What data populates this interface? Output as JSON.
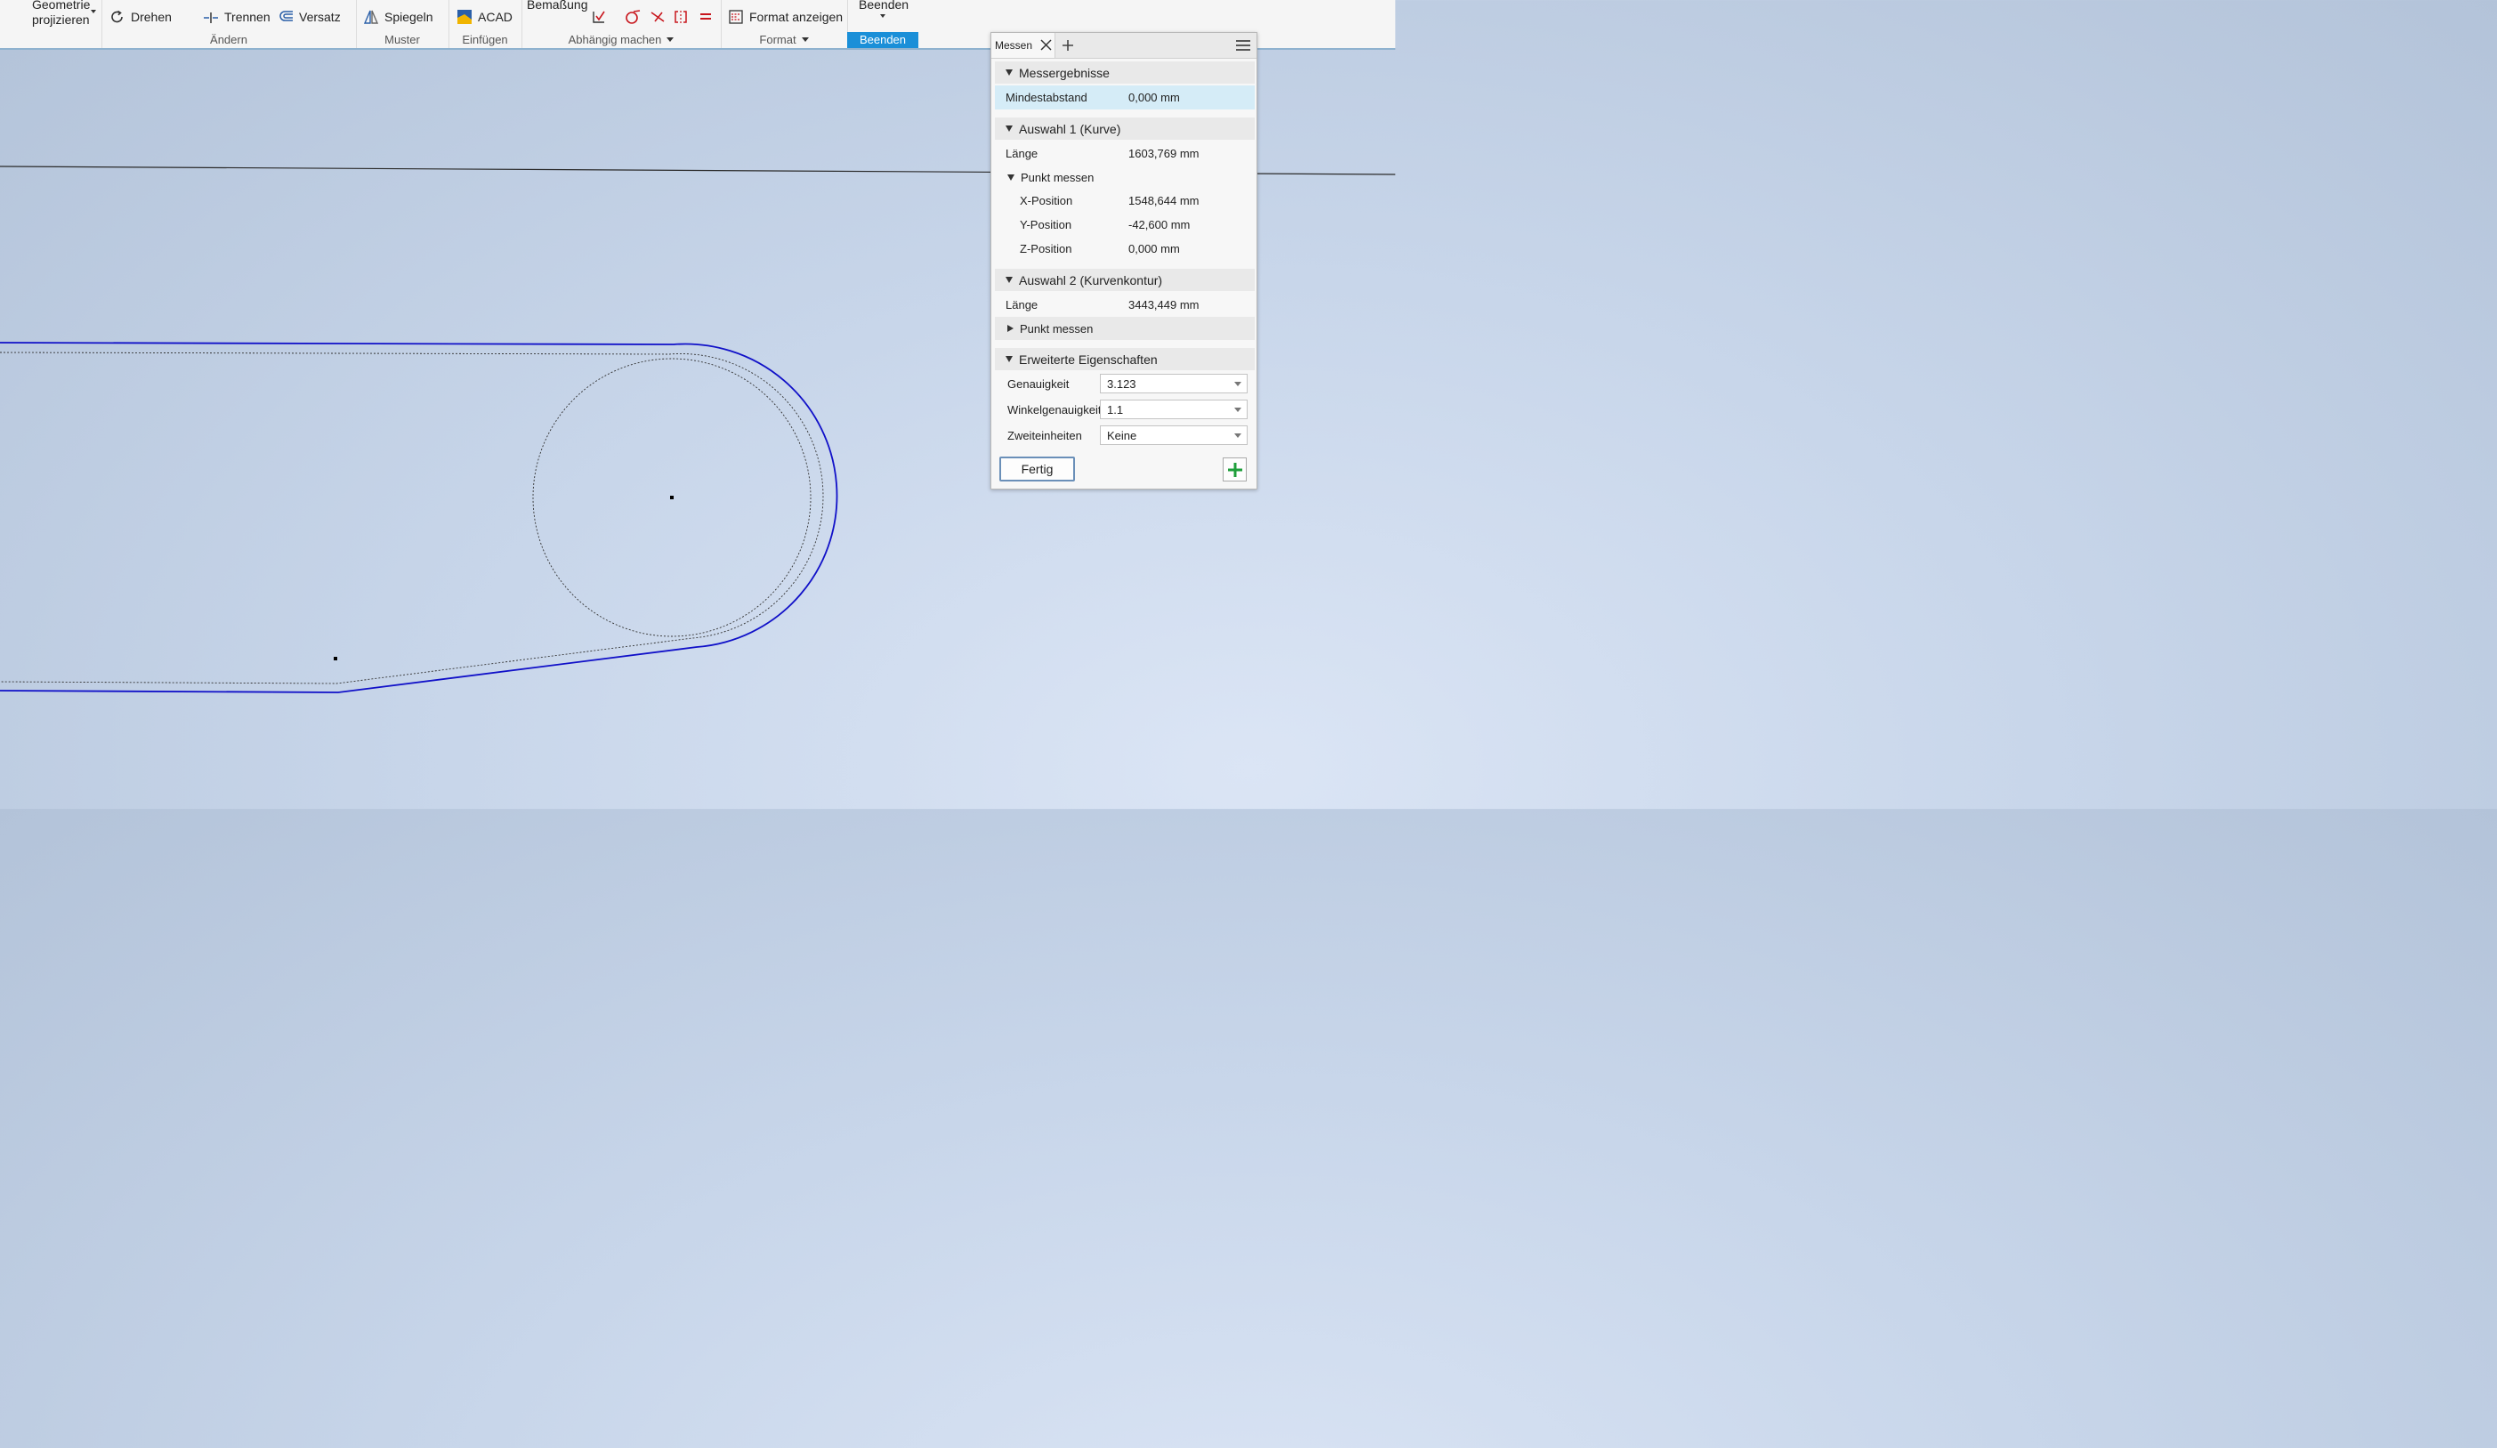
{
  "ribbon": {
    "projizieren": {
      "line1": "Geometrie",
      "line2": "projizieren"
    },
    "aendern": {
      "label": "Ändern",
      "drehen": "Drehen",
      "trennen": "Trennen",
      "versatz": "Versatz"
    },
    "muster": {
      "label": "Muster",
      "spiegeln": "Spiegeln"
    },
    "einfuegen": {
      "label": "Einfügen",
      "acad": "ACAD"
    },
    "abhaengig": {
      "label": "Abhängig machen",
      "bemassung": "Bemaßung"
    },
    "format": {
      "label": "Format",
      "anzeigen": "Format anzeigen"
    },
    "beenden": {
      "button": "Beenden",
      "label": "Beenden"
    }
  },
  "panel": {
    "tab": "Messen",
    "results": {
      "title": "Messergebnisse",
      "min_label": "Mindestabstand",
      "min_value": "0,000 mm"
    },
    "sel1": {
      "title": "Auswahl 1 (Kurve)",
      "len_label": "Länge",
      "len_value": "1603,769 mm",
      "punkt": "Punkt messen",
      "x_label": "X-Position",
      "x_value": "1548,644 mm",
      "y_label": "Y-Position",
      "y_value": "-42,600 mm",
      "z_label": "Z-Position",
      "z_value": "0,000 mm"
    },
    "sel2": {
      "title": "Auswahl 2 (Kurvenkontur)",
      "len_label": "Länge",
      "len_value": "3443,449 mm",
      "punkt": "Punkt messen"
    },
    "adv": {
      "title": "Erweiterte Eigenschaften",
      "genau_label": "Genauigkeit",
      "genau_value": "3.123",
      "winkel_label": "Winkelgenauigkeit",
      "winkel_value": "1.1",
      "zweit_label": "Zweiteinheiten",
      "zweit_value": "Keine"
    },
    "fertig": "Fertig"
  },
  "colors": {
    "accent": "#1a8fd8",
    "sketch": "#1010c8",
    "add_green": "#1e9e3a"
  }
}
